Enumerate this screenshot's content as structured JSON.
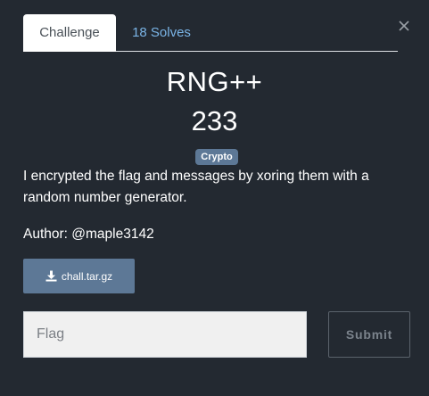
{
  "tabs": [
    {
      "label": "Challenge",
      "active": true
    },
    {
      "label": "18 Solves",
      "active": false
    }
  ],
  "close_icon": "close-icon",
  "challenge": {
    "name": "RNG++",
    "points": "233",
    "category": "Crypto",
    "description": "I encrypted the flag and messages by xoring them with a random number generator.",
    "author": "Author: @maple3142"
  },
  "file": {
    "icon": "download-icon",
    "label": "chall.tar.gz"
  },
  "flag_input": {
    "placeholder": "Flag",
    "value": ""
  },
  "submit_label": "Submit",
  "colors": {
    "background": "#232931",
    "accent": "#5d7896",
    "link": "#7ab4e6"
  }
}
